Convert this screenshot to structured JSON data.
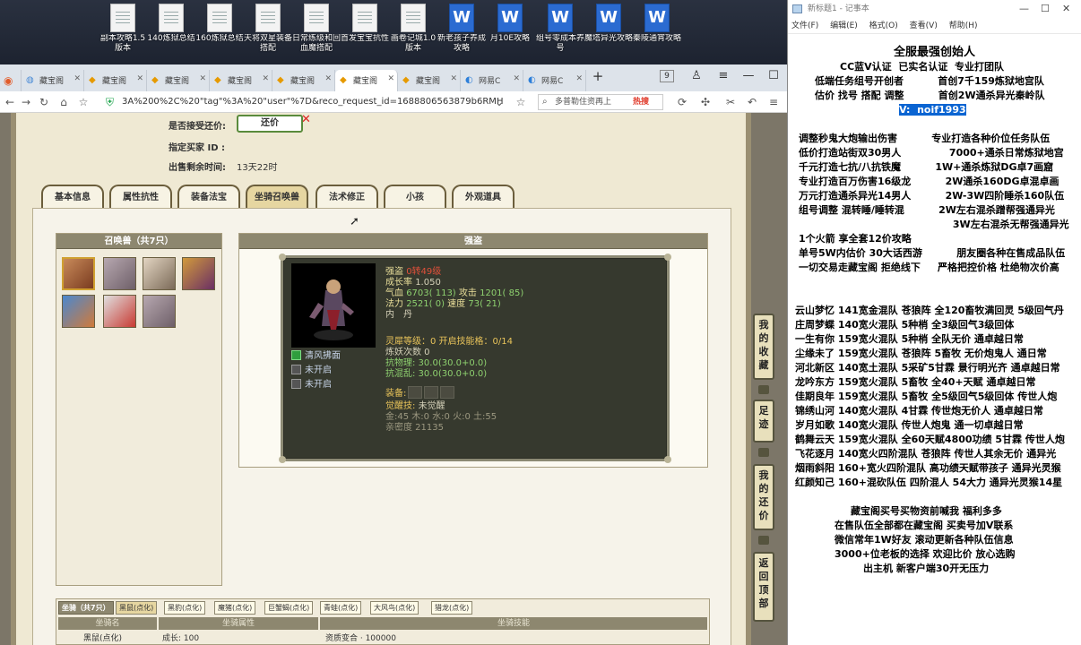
{
  "desktop": {
    "icons": [
      {
        "label": "副本攻略1.5版本",
        "type": "doc"
      },
      {
        "label": "140炼狱总结",
        "type": "doc"
      },
      {
        "label": "160炼狱总结",
        "type": "doc"
      },
      {
        "label": "天将双星装备搭配",
        "type": "doc"
      },
      {
        "label": "日常练级和回血魔搭配",
        "type": "doc"
      },
      {
        "label": "首发宝宝抗性",
        "type": "doc"
      },
      {
        "label": "画卷记城1.0版本",
        "type": "doc"
      },
      {
        "label": "新老孩子养成攻略",
        "type": "word"
      },
      {
        "label": "月10E攻略",
        "type": "word"
      },
      {
        "label": "组号零成本养号",
        "type": "word"
      },
      {
        "label": "魔塔异光攻略",
        "type": "word"
      },
      {
        "label": "秦陵通宵攻略",
        "type": "word"
      }
    ]
  },
  "browser": {
    "tabs": [
      {
        "label": "藏宝阁"
      },
      {
        "label": "藏宝阁"
      },
      {
        "label": "藏宝阁"
      },
      {
        "label": "藏宝阁"
      },
      {
        "label": "藏宝阁"
      },
      {
        "label": "藏宝阁"
      },
      {
        "label": "藏宝阁"
      },
      {
        "label": "网易C"
      },
      {
        "label": "网易C"
      }
    ],
    "tab_count_badge": "9",
    "address": "3A%200%2C%20\"tag\"%3A%20\"user\"%7D&reco_request_id=1688806563879b6RMH",
    "search_placeholder": "多普勒住资再上",
    "hot_label": "热搜"
  },
  "game": {
    "accept_offer_label": "是否接受还价:",
    "offer_button": "还价",
    "buyer_id_label": "指定买家 ID :",
    "time_left_label": "出售剩余时间:",
    "time_left_value": "13天22时",
    "tabs": [
      {
        "label": "基本信息"
      },
      {
        "label": "属性抗性"
      },
      {
        "label": "装备法宝"
      },
      {
        "label": "坐骑召唤兽"
      },
      {
        "label": "法术修正"
      },
      {
        "label": "小孩"
      },
      {
        "label": "外观道具"
      }
    ],
    "active_tab": 3,
    "pets_header": "召唤兽（共7只）",
    "pet_name_header": "强盗",
    "pet": {
      "name_label": "强盗",
      "name_value": "0转49级",
      "growth_label": "成长率",
      "growth_value": "1.050",
      "hp_label": "气血",
      "hp_value": "6703( 113)",
      "atk_label": "攻击",
      "atk_value": "1201( 85)",
      "mp_label": "法力",
      "mp_value": "2521( 0)",
      "spd_label": "速度",
      "spd_value": "73( 21)",
      "element": "内　丹",
      "soul_level": "灵犀等级：0 开启技能格：0/14",
      "refine": "炼妖次数 0",
      "resist_phys": "抗物理: 30.0(30.0+0.0)",
      "resist_mix": "抗混乱: 30.0(30.0+0.0)",
      "equip_label": "装备:",
      "awaken_label": "觉醒技:",
      "awaken_value": "未觉醒",
      "elements_line": "金:45 木:0 水:0 火:0 土:55",
      "affinity_line": "亲密度 21135",
      "skills": [
        {
          "label": "清风拂面"
        },
        {
          "label": "未开启"
        },
        {
          "label": "未开启"
        }
      ]
    },
    "mount": {
      "header": "坐骑（共7只）",
      "tabs": [
        "黑鼠(点化)",
        "黑豹(点化)",
        "魔猪(点化)",
        "巨蟹蝎(点化)",
        "青蛙(点化)",
        "大风鸟(点化)",
        "猎龙(点化)"
      ],
      "cols": [
        "坐骑名",
        "坐骑属性",
        "坐骑技能"
      ],
      "row": [
        "黑鼠(点化)",
        "成长: 100",
        "资质变合 · 100000"
      ]
    },
    "side_buttons": [
      {
        "label": "我的收藏"
      },
      {
        "label": "足迹"
      },
      {
        "label": "我的还价"
      },
      {
        "label": "返回顶部"
      }
    ]
  },
  "notepad": {
    "title": "新标题1 - 记事本",
    "menu": [
      "文件(F)",
      "编辑(E)",
      "格式(O)",
      "查看(V)",
      "帮助(H)"
    ],
    "lines": [
      "全服最强创始人",
      "CC蓝V认证  已实名认证  专业打团队",
      "低端任务组号开创者          首创7千159炼狱地宫队",
      "估价 找号 搭配 调整          首创2W通杀异光秦岭队",
      "V:  noif1993",
      "调整秒鬼大炮输出伤害          专业打造各种价位任务队伍",
      "低价打造站街双30男人              7000+通杀日常炼狱地宫",
      "千元打造七抗/八抗铁魔          1W+通杀炼狱DG卓7画窟",
      "专业打造百万伤害16级龙          2W通杀160DG卓混卓画",
      "万元打造通杀异光14男人          2W-3W四阶睡杀160队伍",
      "组号调整 混转睡/睡转混          2W左右混杀蹭帮强通异光",
      "                                                3W左右混杀无帮强通异光",
      "1个火箭 享全套12价攻略",
      "单号5W内估价 30大话西游          朋友圈各种在售成品队伍",
      "一切交易走藏宝阁 拒绝线下     严格把控价格 杜绝物次价高",
      "云山梦忆 141宽金混队 苍狼阵 全120畜牧满回灵 5级回气丹",
      "庄周梦蝶 140宽火混队 5种梢 全3级回气3级回体",
      "一生有你 159宽火混队 5种梢 全队无价 通卓越日常",
      "尘缘未了 159宽火混队 苍狼阵 5畜牧 无价炮鬼人 通日常",
      "河北新区 140宽土混队 5采矿5甘霖 景行明光齐 通卓越日常",
      "龙吟东方 159宽火混队 5畜牧 全40+天赋 通卓越日常",
      "佳期良年 159宽火混队 5畜牧 全5级回气5级回体 传世人炮",
      "锦绣山河 140宽火混队 4甘霖 传世炮无价人 通卓越日常",
      "岁月如歌 140宽火混队 传世人炮鬼 通一切卓越日常",
      "鹤舞云天 159宽火混队 全60天赋4800功绩 5甘霖 传世人炮",
      "飞花逐月 140宽火四阶混队 苍狼阵 传世人其余无价 通异光",
      "烟雨斜阳 160+宽火四阶混队 高功绩天赋带孩子 通异光灵猴",
      "红颜知己 160+混砍队伍 四阶混人 54大力 通异光灵猴14星",
      "藏宝阁买号买物资前喊我 福利多多",
      "在售队伍全部都在藏宝阁 买卖号加V联系",
      "微信常年1W好友 滚动更新各种队伍信息",
      "3000+位老板的选择 欢迎比价 放心选购",
      "出主机 新客户端30开无压力"
    ]
  }
}
